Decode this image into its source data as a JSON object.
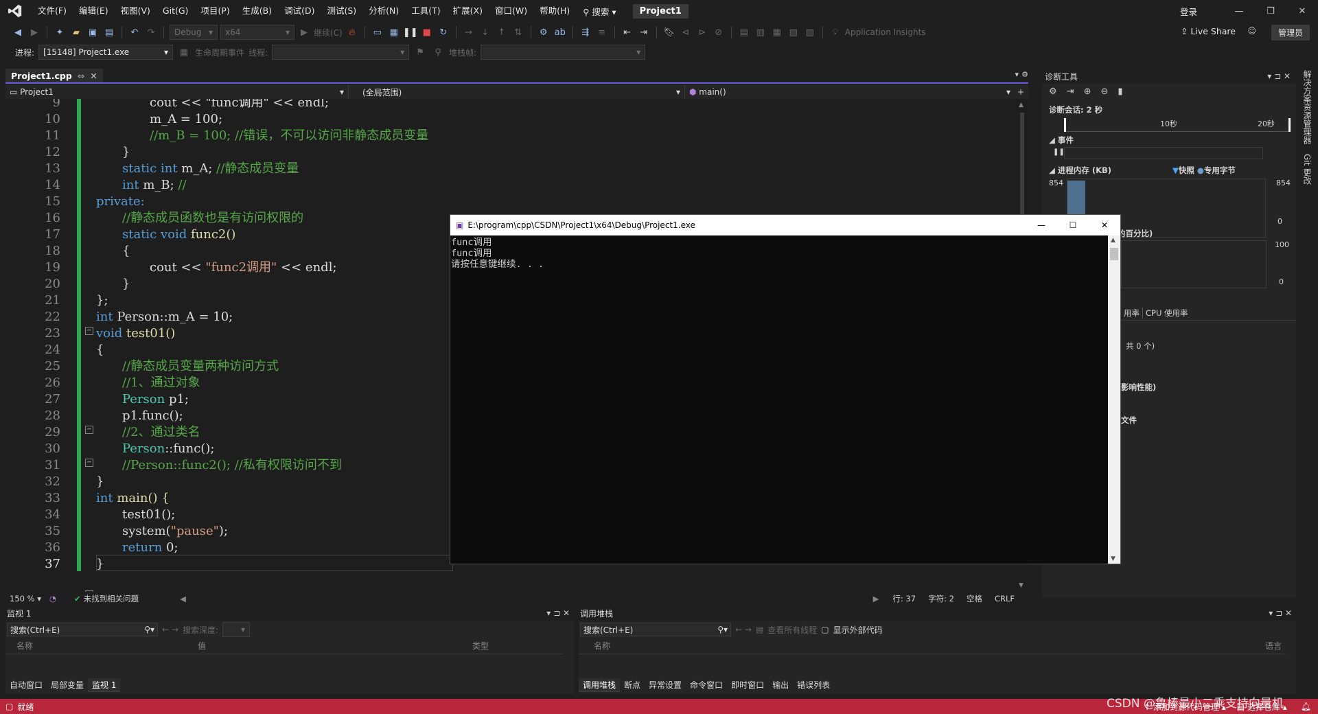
{
  "menu": {
    "items": [
      "文件(F)",
      "编辑(E)",
      "视图(V)",
      "Git(G)",
      "项目(P)",
      "生成(B)",
      "调试(D)",
      "测试(S)",
      "分析(N)",
      "工具(T)",
      "扩展(X)",
      "窗口(W)",
      "帮助(H)"
    ],
    "search_label": "搜索",
    "project_title": "Project1",
    "sign_in": "登录"
  },
  "toolbar": {
    "config": "Debug",
    "platform": "x64",
    "continue_label": "继续(C)",
    "app_insights": "Application Insights",
    "live_share": "Live Share",
    "admin": "管理员"
  },
  "process_bar": {
    "process_label": "进程:",
    "process_value": "[15148] Project1.exe",
    "lifecycle_label": "生命周期事件",
    "thread_label": "线程:",
    "stack_frame_label": "堆栈帧:"
  },
  "editor": {
    "tab_name": "Project1.cpp",
    "nav_project": "Project1",
    "nav_scope": "(全局范围)",
    "nav_function": "main()",
    "line_numbers": [
      "9",
      "10",
      "11",
      "12",
      "13",
      "14",
      "15",
      "16",
      "17",
      "18",
      "19",
      "20",
      "21",
      "22",
      "23",
      "24",
      "25",
      "26",
      "27",
      "28",
      "29",
      "30",
      "31",
      "32",
      "33",
      "34",
      "35",
      "36",
      "37"
    ],
    "zoom": "150 %",
    "issues": "未找到相关问题",
    "line": "行: 37",
    "char": "字符: 2",
    "spaces": "空格",
    "eol": "CRLF"
  },
  "code": {
    "l9": "cout << \"func调用\" << endl;",
    "l10": "m_A = 100;",
    "l11": "//m_B = 100; //错误，不可以访问非静态成员变量",
    "l12": "}",
    "l13_kw": "static int",
    "l13_rest": " m_A; ",
    "l13_cm": "//静态成员变量",
    "l14_kw": "int",
    "l14_rest": " m_B; ",
    "l14_cm": "//",
    "l15": "private:",
    "l16": "//静态成员函数也是有访问权限的",
    "l17_kw": "static void",
    "l17_rest": " func2()",
    "l18": "{",
    "l19_a": "cout << ",
    "l19_str": "\"func2调用\"",
    "l19_b": " << endl;",
    "l20": "}",
    "l21": "};",
    "l22_kw": "int",
    "l22_rest": " Person::m_A = 10;",
    "l23_kw": "void",
    "l23_rest": " test01()",
    "l24": "{",
    "l25": "//静态成员变量两种访问方式",
    "l26": "//1、通过对象",
    "l27_ty": "Person",
    "l27_rest": " p1;",
    "l28": "p1.func();",
    "l29": "//2、通过类名",
    "l30_ty": "Person",
    "l30_rest": "::func();",
    "l31": "//Person::func2(); //私有权限访问不到",
    "l32": "}",
    "l33_kw": "int",
    "l33_rest": " main() {",
    "l34": "test01();",
    "l35_a": "system(",
    "l35_str": "\"pause\"",
    "l35_b": ");",
    "l36_kw": "return",
    "l36_rest": " 0;",
    "l37": "}"
  },
  "console": {
    "title": "E:\\program\\cpp\\CSDN\\Project1\\x64\\Debug\\Project1.exe",
    "lines": [
      "func调用",
      "func调用",
      "请按任意键继续. . ."
    ]
  },
  "diagnostics": {
    "title": "诊断工具",
    "session": "诊断会话: 2 秒",
    "tick_10": "10秒",
    "tick_20": "20秒",
    "events": "事件",
    "process_memory": "进程内存 (KB)",
    "snapshot": "快照",
    "private_bytes": "专用字节",
    "mem_max": "854",
    "mem_min": "0",
    "cpu_label": "的百分比)",
    "cpu_max": "100",
    "cpu_min": "0",
    "tab_usage": "用率",
    "tab_cpu": "CPU 使用率",
    "count": "共 0 个)",
    "perf": "影响性能)",
    "file": "文件"
  },
  "right_strip": {
    "solution_explorer": "解决方案资源管理器",
    "git_changes": "Git 更改"
  },
  "watch": {
    "title": "监视 1",
    "search": "搜索(Ctrl+E)",
    "depth": "搜索深度:",
    "col_name": "名称",
    "col_value": "值",
    "col_type": "类型",
    "tabs": [
      "自动窗口",
      "局部变量",
      "监视 1"
    ]
  },
  "callstack": {
    "title": "调用堆栈",
    "search": "搜索(Ctrl+E)",
    "view_threads": "查看所有线程",
    "show_external": "显示外部代码",
    "col_name": "名称",
    "col_lang": "语言",
    "tabs": [
      "调用堆栈",
      "断点",
      "异常设置",
      "命令窗口",
      "即时窗口",
      "输出",
      "错误列表"
    ]
  },
  "statusbar": {
    "ready": "就绪",
    "add_source": "添加到源代码管理",
    "select_repo": "选择仓库",
    "watermark": "CSDN @鲁棒最小二乘支持向量机"
  }
}
